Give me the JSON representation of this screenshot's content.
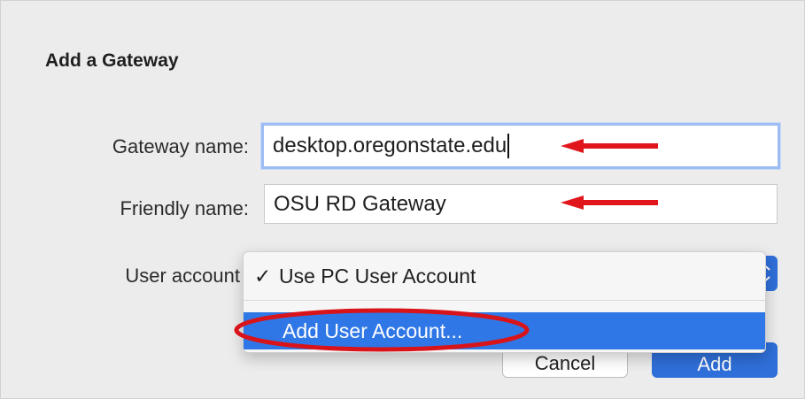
{
  "dialog": {
    "title": "Add a Gateway"
  },
  "form": {
    "gateway_label": "Gateway name:",
    "gateway_value": "desktop.oregonstate.edu",
    "friendly_label": "Friendly name:",
    "friendly_value": "OSU RD Gateway",
    "user_account_label": "User account"
  },
  "dropdown": {
    "items": [
      {
        "label": "Use PC User Account",
        "checked": true,
        "check_glyph": "✓"
      },
      {
        "label": "Add User Account...",
        "highlighted": true
      }
    ]
  },
  "buttons": {
    "cancel_label": "Cancel",
    "add_label": "Add"
  },
  "annotation_colors": {
    "arrow": "#e0161c",
    "oval": "#d8141a",
    "accent": "#2f6fd9",
    "highlight": "#2f77e6"
  },
  "icons": {
    "arrow_icon": "red-left-arrow",
    "check_icon": "checkmark",
    "select_chevron_icon": "updown-chevron"
  }
}
